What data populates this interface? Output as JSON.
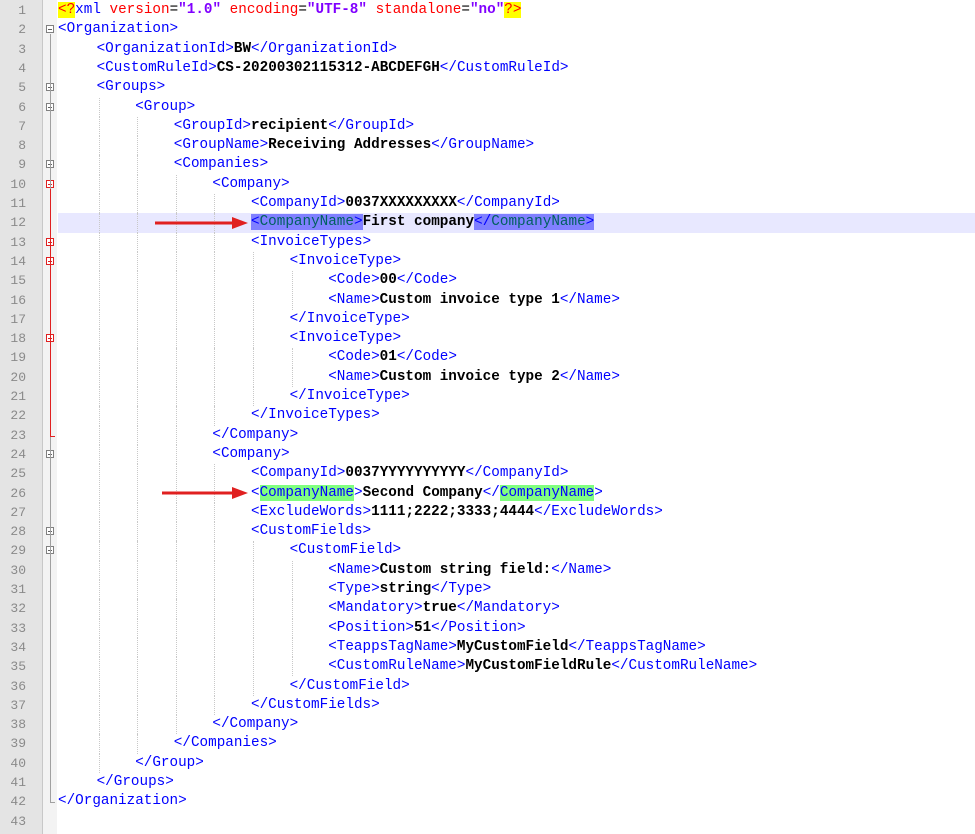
{
  "editor": {
    "lines": [
      {
        "n": "1",
        "parts": [
          [
            "pi",
            "<?"
          ],
          [
            "name",
            "xml"
          ],
          [
            "text",
            " "
          ],
          [
            "attr",
            "version"
          ],
          [
            "text",
            "="
          ],
          [
            "val",
            "\"1.0\""
          ],
          [
            "text",
            " "
          ],
          [
            "attr",
            "encoding"
          ],
          [
            "text",
            "="
          ],
          [
            "val",
            "\"UTF-8\""
          ],
          [
            "text",
            " "
          ],
          [
            "attr",
            "standalone"
          ],
          [
            "text",
            "="
          ],
          [
            "val",
            "\"no\""
          ],
          [
            "pi",
            "?>"
          ]
        ]
      },
      {
        "n": "2",
        "indent": 0,
        "parts": [
          [
            "tag",
            "<Organization>"
          ]
        ]
      },
      {
        "n": "3",
        "indent": 1,
        "parts": [
          [
            "tag",
            "<OrganizationId>"
          ],
          [
            "body",
            "BW"
          ],
          [
            "tag",
            "</OrganizationId>"
          ]
        ]
      },
      {
        "n": "4",
        "indent": 1,
        "parts": [
          [
            "tag",
            "<CustomRuleId>"
          ],
          [
            "body",
            "CS-20200302115312-ABCDEFGH"
          ],
          [
            "tag",
            "</CustomRuleId>"
          ]
        ]
      },
      {
        "n": "5",
        "indent": 1,
        "parts": [
          [
            "tag",
            "<Groups>"
          ]
        ]
      },
      {
        "n": "6",
        "indent": 2,
        "parts": [
          [
            "tag",
            "<Group>"
          ]
        ]
      },
      {
        "n": "7",
        "indent": 3,
        "parts": [
          [
            "tag",
            "<GroupId>"
          ],
          [
            "body",
            "recipient"
          ],
          [
            "tag",
            "</GroupId>"
          ]
        ]
      },
      {
        "n": "8",
        "indent": 3,
        "parts": [
          [
            "tag",
            "<GroupName>"
          ],
          [
            "body",
            "Receiving Addresses"
          ],
          [
            "tag",
            "</GroupName>"
          ]
        ]
      },
      {
        "n": "9",
        "indent": 3,
        "parts": [
          [
            "tag",
            "<Companies>"
          ]
        ]
      },
      {
        "n": "10",
        "indent": 4,
        "parts": [
          [
            "tag",
            "<Company>"
          ]
        ]
      },
      {
        "n": "11",
        "indent": 5,
        "parts": [
          [
            "tag",
            "<CompanyId>"
          ],
          [
            "body",
            "0037XXXXXXXXX"
          ],
          [
            "tag",
            "</CompanyId>"
          ]
        ]
      },
      {
        "n": "12",
        "indent": 5,
        "active": true,
        "parts": [
          [
            "tagp",
            "<"
          ],
          [
            "tagph",
            "CompanyName"
          ],
          [
            "tagp",
            ">"
          ],
          [
            "body",
            "First company"
          ],
          [
            "tagp",
            "</"
          ],
          [
            "tagph",
            "CompanyName"
          ],
          [
            "tagp",
            ">"
          ]
        ]
      },
      {
        "n": "13",
        "indent": 5,
        "parts": [
          [
            "tag",
            "<InvoiceTypes>"
          ]
        ]
      },
      {
        "n": "14",
        "indent": 6,
        "parts": [
          [
            "tag",
            "<InvoiceType>"
          ]
        ]
      },
      {
        "n": "15",
        "indent": 7,
        "parts": [
          [
            "tag",
            "<Code>"
          ],
          [
            "body",
            "00"
          ],
          [
            "tag",
            "</Code>"
          ]
        ]
      },
      {
        "n": "16",
        "indent": 7,
        "parts": [
          [
            "tag",
            "<Name>"
          ],
          [
            "body",
            "Custom invoice type 1"
          ],
          [
            "tag",
            "</Name>"
          ]
        ]
      },
      {
        "n": "17",
        "indent": 6,
        "parts": [
          [
            "tag",
            "</InvoiceType>"
          ]
        ]
      },
      {
        "n": "18",
        "indent": 6,
        "parts": [
          [
            "tag",
            "<InvoiceType>"
          ]
        ]
      },
      {
        "n": "19",
        "indent": 7,
        "parts": [
          [
            "tag",
            "<Code>"
          ],
          [
            "body",
            "01"
          ],
          [
            "tag",
            "</Code>"
          ]
        ]
      },
      {
        "n": "20",
        "indent": 7,
        "parts": [
          [
            "tag",
            "<Name>"
          ],
          [
            "body",
            "Custom invoice type 2"
          ],
          [
            "tag",
            "</Name>"
          ]
        ]
      },
      {
        "n": "21",
        "indent": 6,
        "parts": [
          [
            "tag",
            "</InvoiceType>"
          ]
        ]
      },
      {
        "n": "22",
        "indent": 5,
        "parts": [
          [
            "tag",
            "</InvoiceTypes>"
          ]
        ]
      },
      {
        "n": "23",
        "indent": 4,
        "parts": [
          [
            "tag",
            "</Company>"
          ]
        ]
      },
      {
        "n": "24",
        "indent": 4,
        "parts": [
          [
            "tag",
            "<Company>"
          ]
        ]
      },
      {
        "n": "25",
        "indent": 5,
        "parts": [
          [
            "tag",
            "<CompanyId>"
          ],
          [
            "body",
            "0037YYYYYYYYYY"
          ],
          [
            "tag",
            "</CompanyId>"
          ]
        ]
      },
      {
        "n": "26",
        "indent": 5,
        "parts": [
          [
            "tag",
            "<"
          ],
          [
            "tagg",
            "CompanyName"
          ],
          [
            "tag",
            ">"
          ],
          [
            "body",
            "Second Company"
          ],
          [
            "tag",
            "</"
          ],
          [
            "tagg",
            "CompanyName"
          ],
          [
            "tag",
            ">"
          ]
        ]
      },
      {
        "n": "27",
        "indent": 5,
        "parts": [
          [
            "tag",
            "<ExcludeWords>"
          ],
          [
            "body",
            "1111;2222;3333;4444"
          ],
          [
            "tag",
            "</ExcludeWords>"
          ]
        ]
      },
      {
        "n": "28",
        "indent": 5,
        "parts": [
          [
            "tag",
            "<CustomFields>"
          ]
        ]
      },
      {
        "n": "29",
        "indent": 6,
        "parts": [
          [
            "tag",
            "<CustomField>"
          ]
        ]
      },
      {
        "n": "30",
        "indent": 7,
        "parts": [
          [
            "tag",
            "<Name>"
          ],
          [
            "body",
            "Custom string field:"
          ],
          [
            "tag",
            "</Name>"
          ]
        ]
      },
      {
        "n": "31",
        "indent": 7,
        "parts": [
          [
            "tag",
            "<Type>"
          ],
          [
            "body",
            "string"
          ],
          [
            "tag",
            "</Type>"
          ]
        ]
      },
      {
        "n": "32",
        "indent": 7,
        "parts": [
          [
            "tag",
            "<Mandatory>"
          ],
          [
            "body",
            "true"
          ],
          [
            "tag",
            "</Mandatory>"
          ]
        ]
      },
      {
        "n": "33",
        "indent": 7,
        "parts": [
          [
            "tag",
            "<Position>"
          ],
          [
            "body",
            "51"
          ],
          [
            "tag",
            "</Position>"
          ]
        ]
      },
      {
        "n": "34",
        "indent": 7,
        "parts": [
          [
            "tag",
            "<TeappsTagName>"
          ],
          [
            "body",
            "MyCustomField"
          ],
          [
            "tag",
            "</TeappsTagName>"
          ]
        ]
      },
      {
        "n": "35",
        "indent": 7,
        "parts": [
          [
            "tag",
            "<CustomRuleName>"
          ],
          [
            "body",
            "MyCustomFieldRule"
          ],
          [
            "tag",
            "</CustomRuleName>"
          ]
        ]
      },
      {
        "n": "36",
        "indent": 6,
        "parts": [
          [
            "tag",
            "</CustomField>"
          ]
        ]
      },
      {
        "n": "37",
        "indent": 5,
        "parts": [
          [
            "tag",
            "</CustomFields>"
          ]
        ]
      },
      {
        "n": "38",
        "indent": 4,
        "parts": [
          [
            "tag",
            "</Company>"
          ]
        ]
      },
      {
        "n": "39",
        "indent": 3,
        "parts": [
          [
            "tag",
            "</Companies>"
          ]
        ]
      },
      {
        "n": "40",
        "indent": 2,
        "parts": [
          [
            "tag",
            "</Group>"
          ]
        ]
      },
      {
        "n": "41",
        "indent": 1,
        "parts": [
          [
            "tag",
            "</Groups>"
          ]
        ]
      },
      {
        "n": "42",
        "indent": 0,
        "parts": [
          [
            "tag",
            "</Organization>"
          ]
        ]
      },
      {
        "n": "43",
        "parts": []
      }
    ],
    "folds": [
      "2",
      "5",
      "6",
      "9",
      "10",
      "13",
      "14",
      "18",
      "24",
      "28",
      "29"
    ],
    "red_folds": [
      "10",
      "13",
      "14",
      "18"
    ],
    "arrow_lines": [
      "12",
      "26"
    ]
  },
  "colors": {
    "tag": "#0000ff",
    "body": "#000000",
    "attr": "#ff0000",
    "val": "#8000ff",
    "pi_bg": "#ffff00",
    "active_line": "#e8e8ff",
    "match_purple": "#8080ff",
    "match_green": "#80ff80",
    "arrow": "#e02020"
  }
}
